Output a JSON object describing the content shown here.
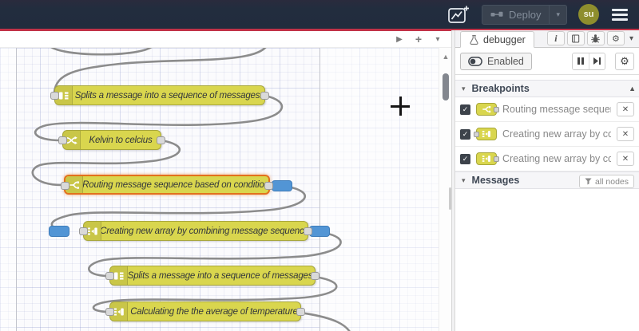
{
  "colors": {
    "header_bg": "#212c3d",
    "accent_red": "#c13247",
    "node_yellow": "#d9d64e",
    "node_border": "#a8a73b",
    "selected_orange": "#e2711d",
    "breakpoint_blue": "#5295d5",
    "wire_gray": "#8c8c8c",
    "avatar_olive": "#8e8e2d"
  },
  "icons": {
    "play": "▶",
    "plus": "+",
    "chevron_down": "▾",
    "chevron_section": "⌵",
    "scroll_up": "▲",
    "check": "✓",
    "close": "✕",
    "gear": "⚙"
  },
  "header": {
    "deploy_label": "Deploy",
    "avatar_text": "su"
  },
  "canvas": {
    "nodes": [
      {
        "type": "split",
        "label": "Splits a message into a sequence of messages."
      },
      {
        "type": "change",
        "label": "Kelvin to celcius"
      },
      {
        "type": "switch",
        "label": "Routing message sequence based on condition",
        "selected": true,
        "breakpoint": "output"
      },
      {
        "type": "join",
        "label": "Creating new array by combining message sequence",
        "breakpoint": "input,output"
      },
      {
        "type": "split",
        "label": "Splits a message into a sequence of messages."
      },
      {
        "type": "join",
        "label": "Calculating the the average of temperature"
      }
    ]
  },
  "sidebar": {
    "tab_label": "debugger",
    "enabled_label": "Enabled",
    "breakpoints_title": "Breakpoints",
    "messages_title": "Messages",
    "filter_button": "all nodes",
    "breakpoints": [
      {
        "node_type": "switch",
        "port": "output",
        "label": "Routing message sequence based on condition"
      },
      {
        "node_type": "join",
        "port": "input",
        "label": "Creating new array by combining message sequence"
      },
      {
        "node_type": "join",
        "port": "output",
        "label": "Creating new array by combining message sequence"
      }
    ]
  }
}
